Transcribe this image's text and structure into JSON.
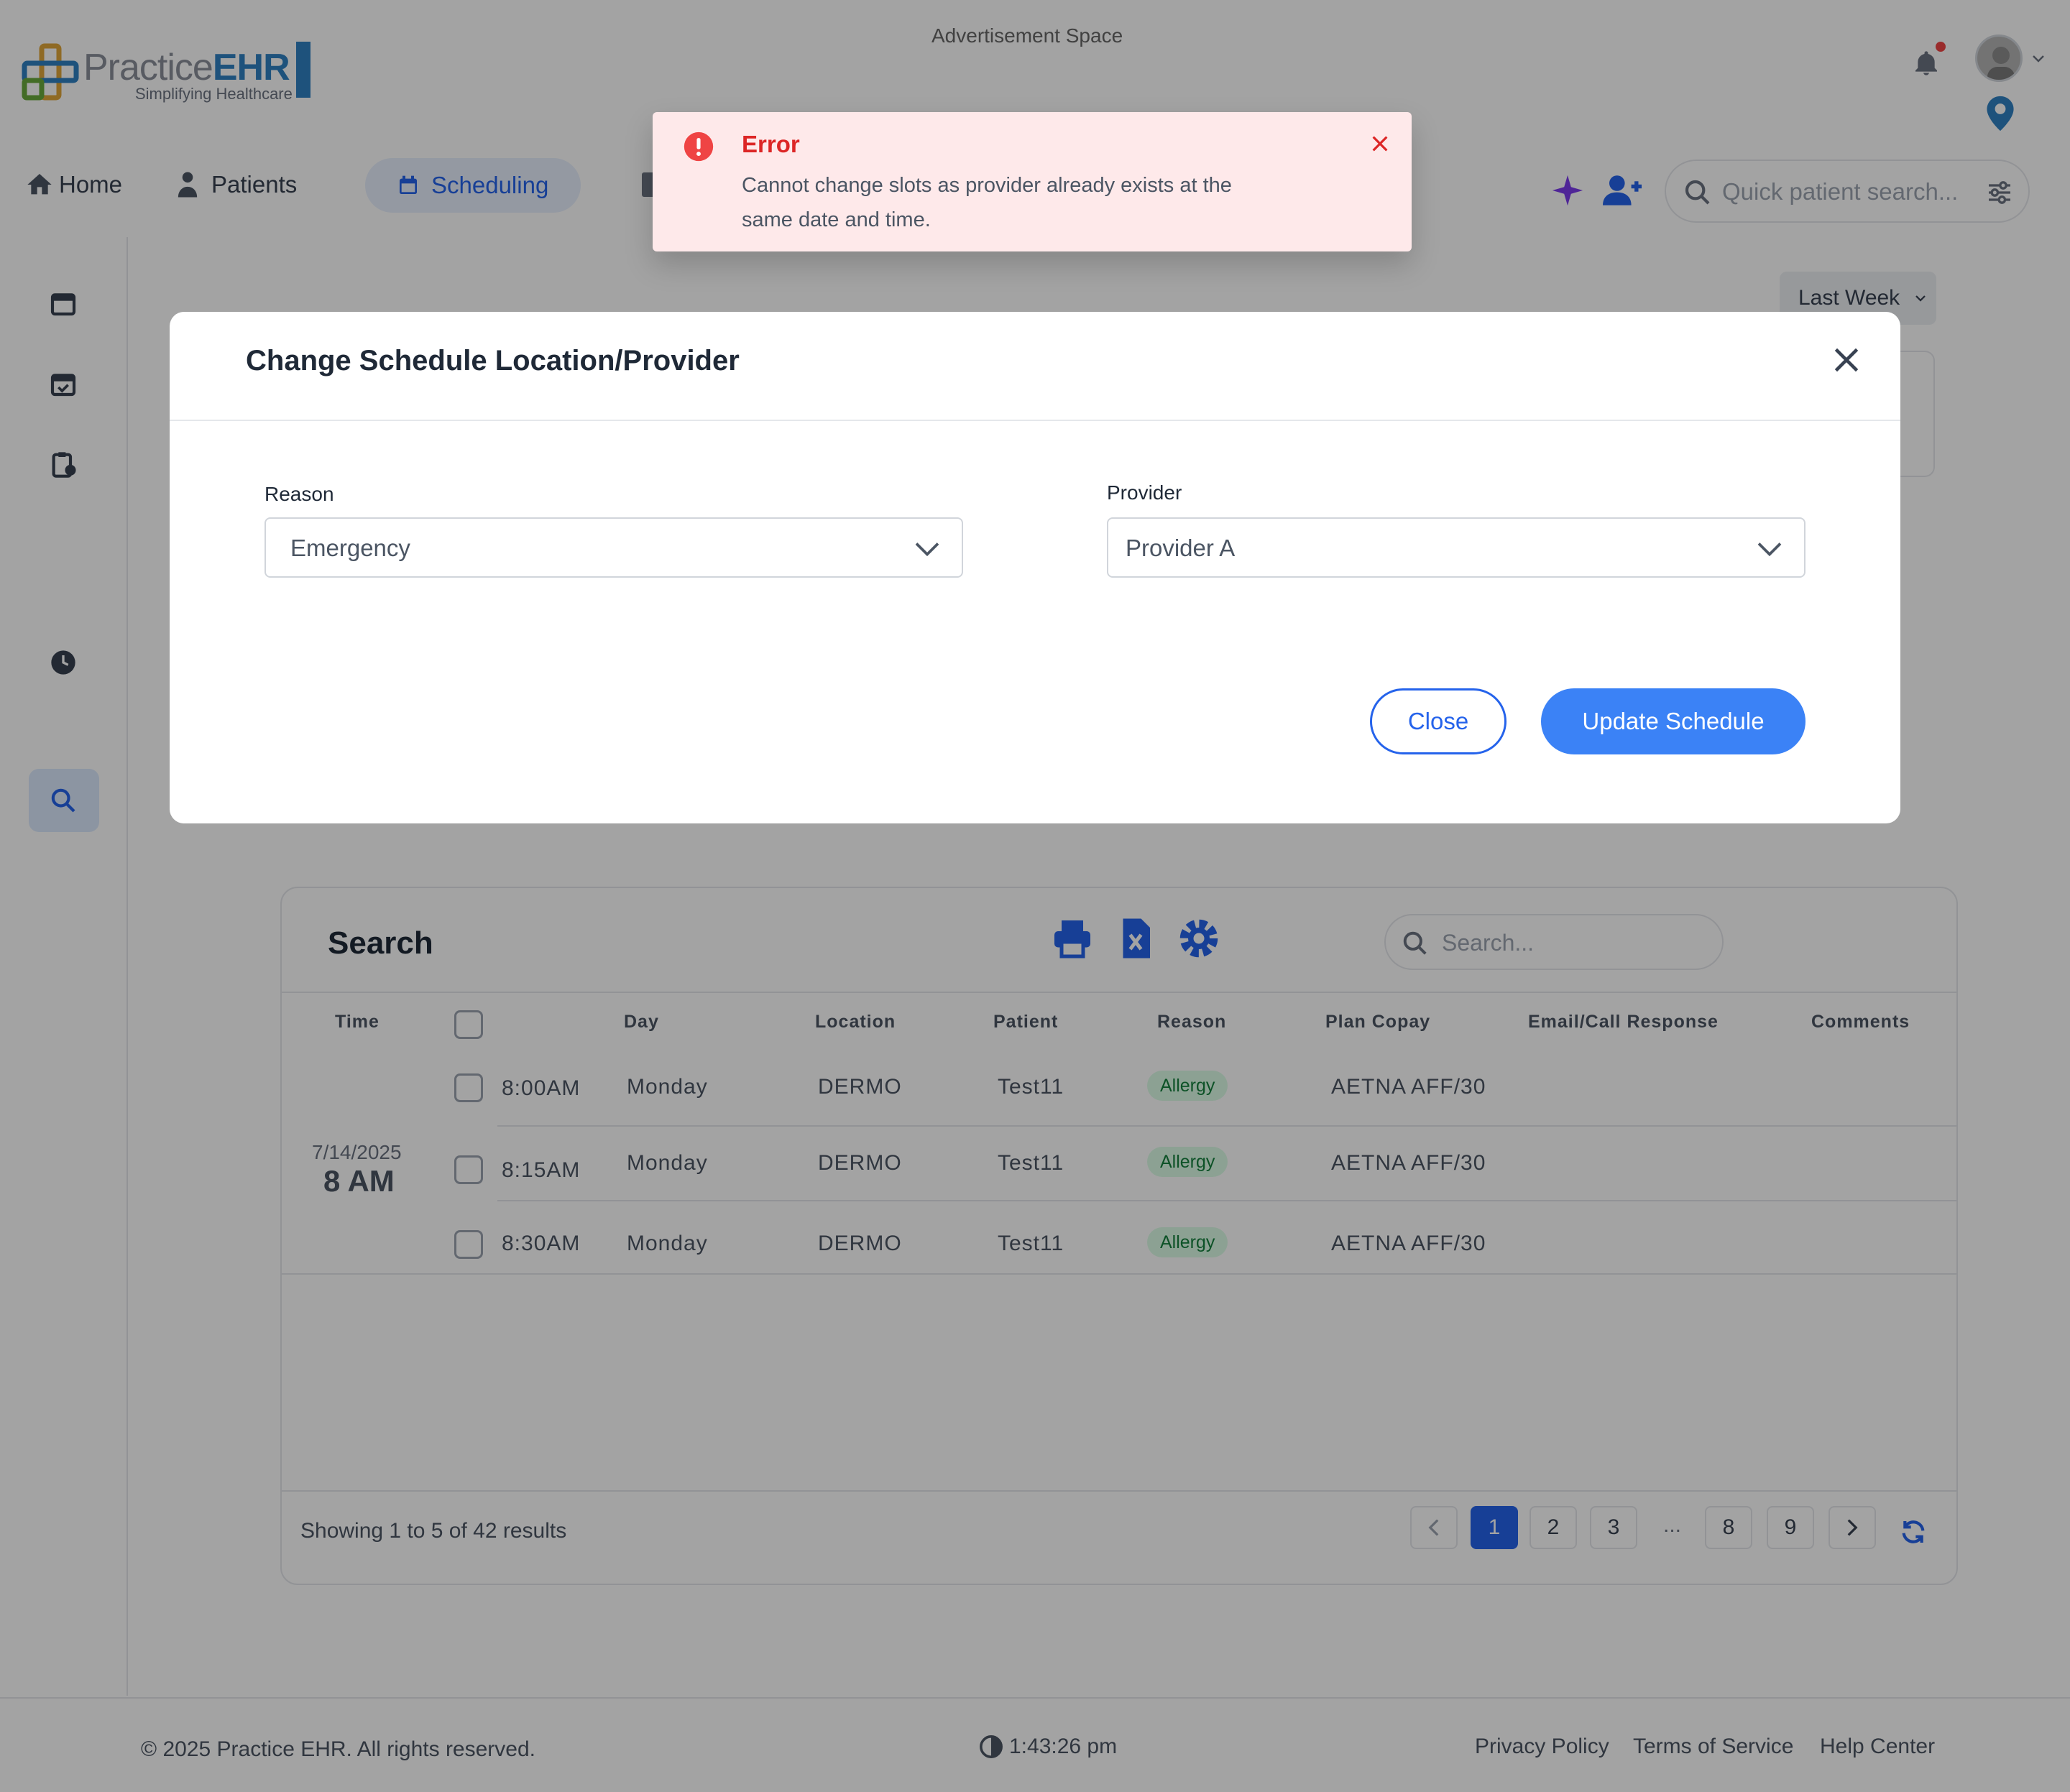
{
  "header": {
    "logo": {
      "word_light": "Practice",
      "word_bold": "EHR",
      "tagline": "Simplifying Healthcare"
    },
    "advertisement": "Advertisement Space",
    "icons": {
      "bell": "bell-icon",
      "avatar": "user-avatar",
      "location": "map-pin-icon"
    }
  },
  "nav": {
    "home": "Home",
    "patients": "Patients",
    "scheduling": "Scheduling",
    "quick_search_placeholder": "Quick patient search..."
  },
  "filters": {
    "range": "Last Week"
  },
  "search_card": {
    "title": "Search",
    "search_placeholder": "Search...",
    "columns": [
      "Time",
      "Day",
      "Location",
      "Patient",
      "Reason",
      "Plan Copay",
      "Email/Call Response",
      "Comments"
    ],
    "group": {
      "date": "7/14/2025",
      "hour": "8 AM"
    },
    "rows": [
      {
        "time": "8:00AM",
        "day": "Monday",
        "location": "DERMO",
        "patient": "Test11",
        "reason": "Allergy",
        "plan_copay": "AETNA AFF/30"
      },
      {
        "time": "8:15AM",
        "day": "Monday",
        "location": "DERMO",
        "patient": "Test11",
        "reason": "Allergy",
        "plan_copay": "AETNA AFF/30"
      },
      {
        "time": "8:30AM",
        "day": "Monday",
        "location": "DERMO",
        "patient": "Test11",
        "reason": "Allergy",
        "plan_copay": "AETNA AFF/30"
      }
    ],
    "showing": "Showing 1 to 5 of 42 results",
    "pages": [
      "1",
      "2",
      "3",
      "...",
      "8",
      "9"
    ],
    "current_page": "1"
  },
  "footer": {
    "copyright": "© 2025 Practice EHR. All rights reserved.",
    "time": "1:43:26 pm",
    "links": [
      "Privacy Policy",
      "Terms of Service",
      "Help Center"
    ]
  },
  "modal": {
    "title": "Change Schedule Location/Provider",
    "reason_label": "Reason",
    "reason_value": "Emergency",
    "provider_label": "Provider",
    "provider_value": "Provider A",
    "close_label": "Close",
    "update_label": "Update Schedule"
  },
  "toast": {
    "title": "Error",
    "message": "Cannot change slots as provider already exists at the same date and time."
  },
  "colors": {
    "primary": "#3b82f6",
    "error": "#dc2626",
    "error_bg": "#fee9ea",
    "badge_bg": "#dcfce7",
    "badge_text": "#15803d"
  }
}
